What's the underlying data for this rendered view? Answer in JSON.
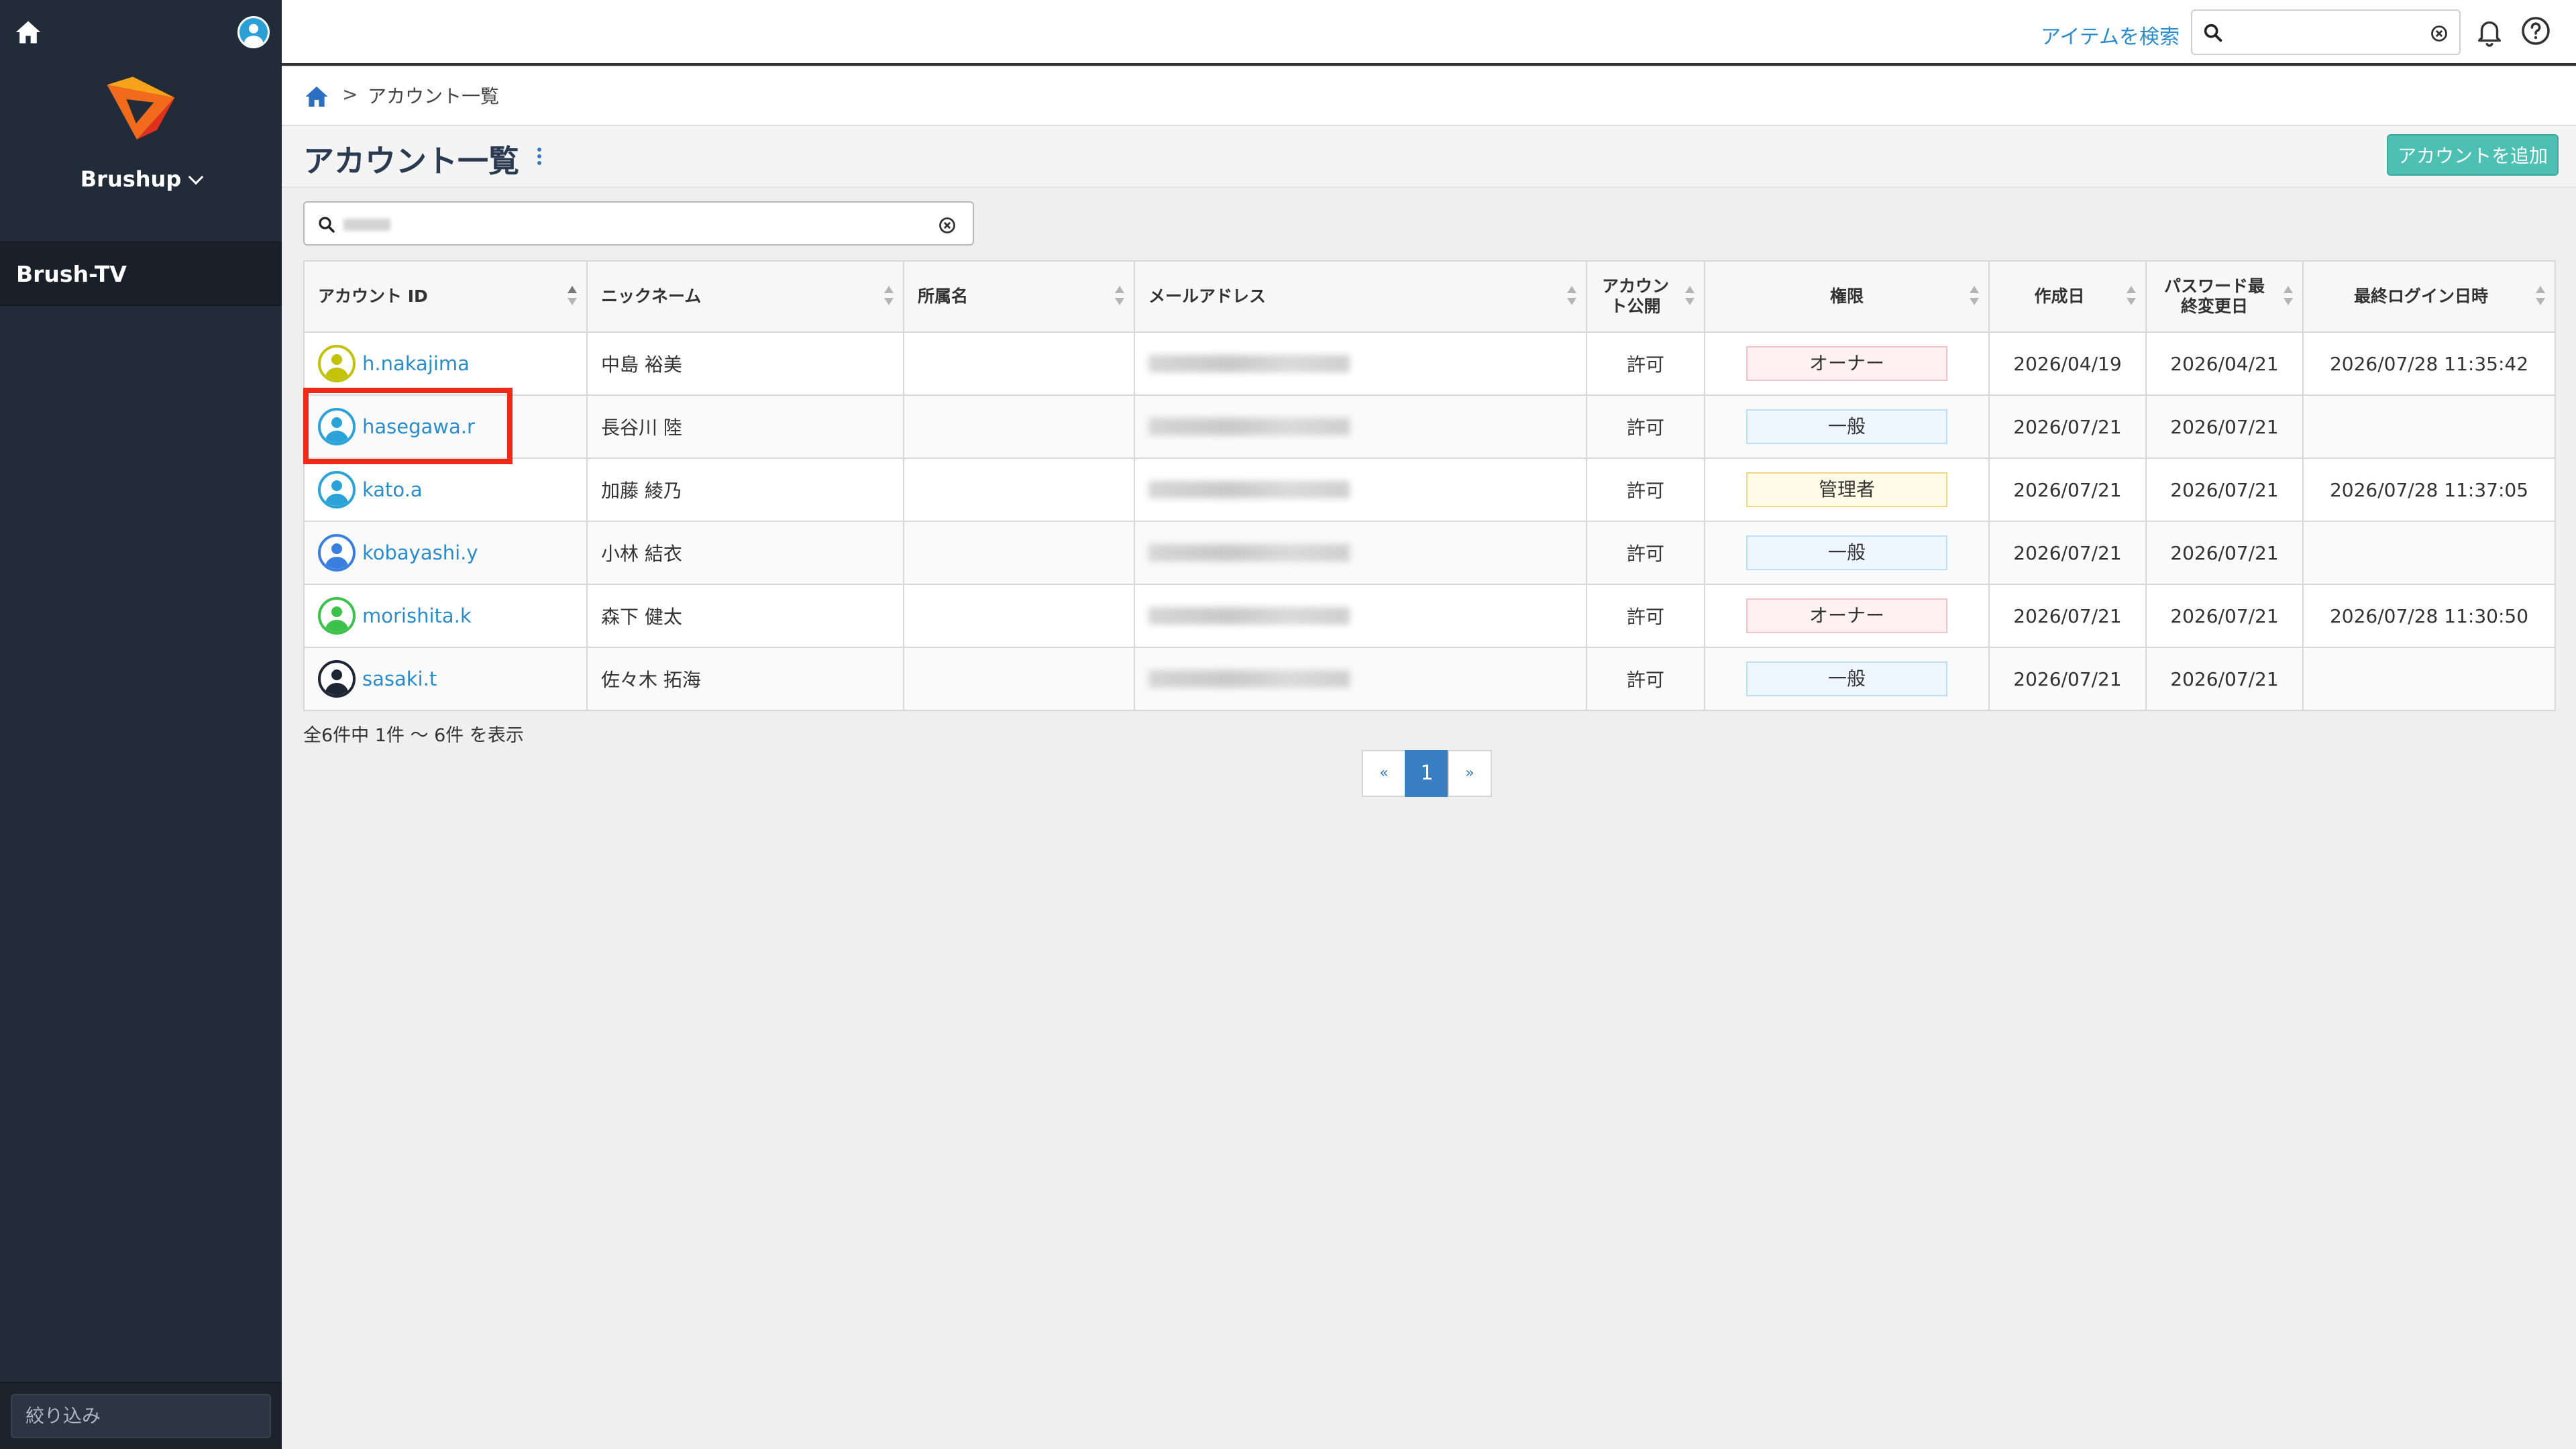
{
  "sidebar": {
    "workspace": "Brushup",
    "project": "Brush-TV",
    "filter_placeholder": "絞り込み"
  },
  "topbar": {
    "search_link": "アイテムを検索",
    "search_placeholder": ""
  },
  "breadcrumb": {
    "separator": ">",
    "current": "アカウント一覧"
  },
  "page": {
    "title": "アカウント一覧",
    "add_button": "アカウントを追加"
  },
  "table": {
    "headers": {
      "account_id": "アカウント ID",
      "nickname": "ニックネーム",
      "affiliation": "所属名",
      "email": "メールアドレス",
      "public": "アカウント公開",
      "role": "権限",
      "created": "作成日",
      "pw_changed": "パスワード最終変更日",
      "last_login": "最終ログイン日時"
    },
    "rows": [
      {
        "id": "h.nakajima",
        "nickname": "中島 裕美",
        "affiliation": "",
        "public": "許可",
        "role": "オーナー",
        "role_type": "owner",
        "created": "2026/04/19",
        "pw_changed": "2026/04/21",
        "last_login": "2026/07/28 11:35:42",
        "avatar_color": "#c2c20a"
      },
      {
        "id": "hasegawa.r",
        "nickname": "長谷川 陸",
        "affiliation": "",
        "public": "許可",
        "role": "一般",
        "role_type": "general",
        "created": "2026/07/21",
        "pw_changed": "2026/07/21",
        "last_login": "",
        "avatar_color": "#2ba3d8"
      },
      {
        "id": "kato.a",
        "nickname": "加藤 綾乃",
        "affiliation": "",
        "public": "許可",
        "role": "管理者",
        "role_type": "admin",
        "created": "2026/07/21",
        "pw_changed": "2026/07/21",
        "last_login": "2026/07/28 11:37:05",
        "avatar_color": "#2ba3d8"
      },
      {
        "id": "kobayashi.y",
        "nickname": "小林 結衣",
        "affiliation": "",
        "public": "許可",
        "role": "一般",
        "role_type": "general",
        "created": "2026/07/21",
        "pw_changed": "2026/07/21",
        "last_login": "",
        "avatar_color": "#3a7fe0"
      },
      {
        "id": "morishita.k",
        "nickname": "森下 健太",
        "affiliation": "",
        "public": "許可",
        "role": "オーナー",
        "role_type": "owner",
        "created": "2026/07/21",
        "pw_changed": "2026/07/21",
        "last_login": "2026/07/28 11:30:50",
        "avatar_color": "#3cc24a"
      },
      {
        "id": "sasaki.t",
        "nickname": "佐々木 拓海",
        "affiliation": "",
        "public": "許可",
        "role": "一般",
        "role_type": "general",
        "created": "2026/07/21",
        "pw_changed": "2026/07/21",
        "last_login": "",
        "avatar_color": "#1e2633"
      }
    ]
  },
  "count_text": "全6件中 1件 〜 6件 を表示",
  "pagination": {
    "prev": "«",
    "current": "1",
    "next": "»"
  }
}
